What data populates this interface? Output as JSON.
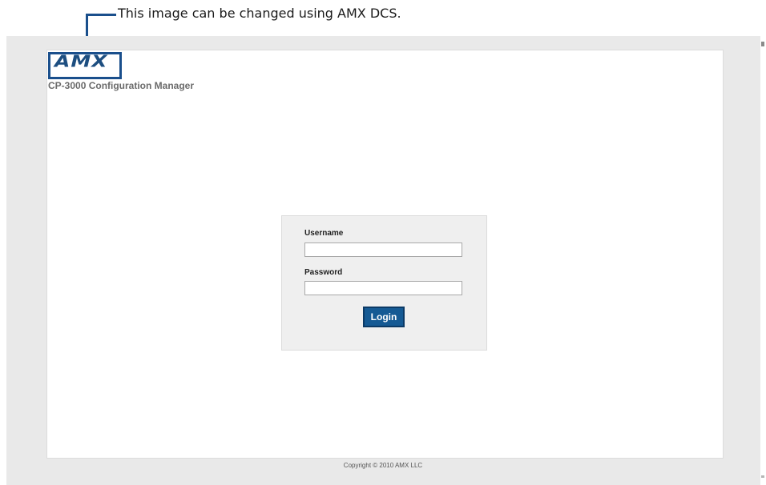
{
  "callout": {
    "text": "This image can be changed using AMX DCS.",
    "color": "#1a4f8c"
  },
  "header": {
    "logo_text": "AMX",
    "app_title": "CP-3000 Configuration Manager",
    "logo_color": "#1d4e80"
  },
  "login": {
    "username_label": "Username",
    "username_value": "",
    "password_label": "Password",
    "password_value": "",
    "button_label": "Login",
    "button_color": "#155a94"
  },
  "footer": {
    "copyright": "Copyright © 2010 AMX LLC"
  }
}
